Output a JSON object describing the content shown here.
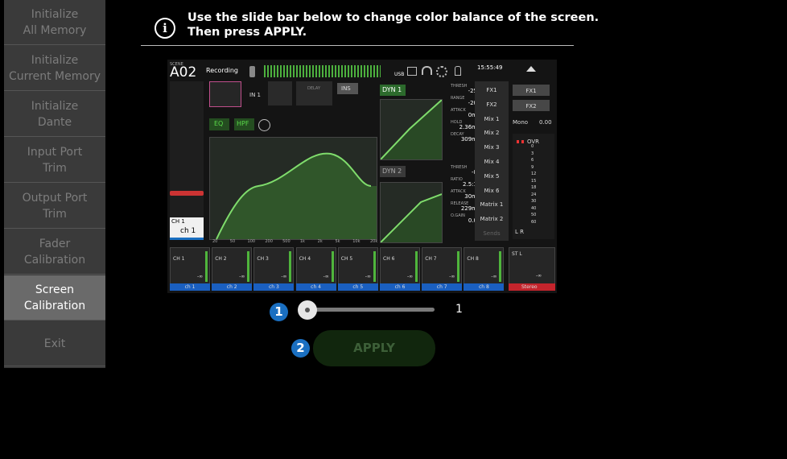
{
  "sidebar": {
    "items": [
      {
        "lines": [
          "Initialize",
          "All Memory"
        ],
        "active": false
      },
      {
        "lines": [
          "Initialize",
          "Current Memory"
        ],
        "active": false
      },
      {
        "lines": [
          "Initialize",
          "Dante"
        ],
        "active": false
      },
      {
        "lines": [
          "Input Port",
          "Trim"
        ],
        "active": false
      },
      {
        "lines": [
          "Output Port",
          "Trim"
        ],
        "active": false
      },
      {
        "lines": [
          "Fader",
          "Calibration"
        ],
        "active": false
      },
      {
        "lines": [
          "Screen",
          "Calibration"
        ],
        "active": true
      },
      {
        "lines": [
          "Exit"
        ],
        "active": false
      }
    ]
  },
  "instruction": {
    "line1": "Use the slide bar below to change color balance of the screen.",
    "line2": "Then press APPLY."
  },
  "preview": {
    "scene_label": "SCENE",
    "scene_number": "A02",
    "scene_name": "Recording",
    "usb_label": "USB",
    "time": "15:55:49",
    "eq_label": "EQ",
    "hpf_label": "HPF",
    "dyn1_label": "DYN 1",
    "dyn2_label": "DYN 2",
    "ins_label": "INS",
    "delay_label": "DELAY",
    "in1_label": "IN 1",
    "dyn1_params": [
      {
        "name": "THRESH",
        "value": "-25"
      },
      {
        "name": "RANGE",
        "value": "-20"
      },
      {
        "name": "ATTACK",
        "value": "0m"
      },
      {
        "name": "HOLD",
        "value": "2.36m"
      },
      {
        "name": "DECAY",
        "value": "309m"
      }
    ],
    "dyn2_params": [
      {
        "name": "THRESH",
        "value": "-8"
      },
      {
        "name": "RATIO",
        "value": "2.5:1"
      },
      {
        "name": "ATTACK",
        "value": "30m"
      },
      {
        "name": "RELEASE",
        "value": "229m"
      },
      {
        "name": "O.GAIN",
        "value": "0.0"
      }
    ],
    "send_buttons": [
      "FX1",
      "FX2",
      "Mix 1",
      "Mix 2",
      "Mix 3",
      "Mix 4",
      "Mix 5",
      "Mix 6",
      "Matrix 1",
      "Matrix 2",
      "Sends"
    ],
    "fx_buttons": [
      "FX1",
      "FX2"
    ],
    "mono_label": "Mono",
    "mono_value": "0.00",
    "ovr_label": "OVR",
    "meter_scale": [
      "0",
      "3",
      "6",
      "9",
      "12",
      "15",
      "18",
      "24",
      "30",
      "40",
      "50",
      "60"
    ],
    "lr_label": "L  R",
    "freq_labels": [
      "20",
      "50",
      "100",
      "200",
      "500",
      "1k",
      "2k",
      "5k",
      "10k",
      "20k"
    ],
    "channel_name": "CH 1",
    "channel_sub": "ch 1",
    "channels": [
      {
        "top": "CH 1",
        "bottom": "ch 1",
        "value": "-∞"
      },
      {
        "top": "CH 2",
        "bottom": "ch 2",
        "value": "-∞"
      },
      {
        "top": "CH 3",
        "bottom": "ch 3",
        "value": "-∞"
      },
      {
        "top": "CH 4",
        "bottom": "ch 4",
        "value": "-∞"
      },
      {
        "top": "CH 5",
        "bottom": "ch 5",
        "value": "-∞"
      },
      {
        "top": "CH 6",
        "bottom": "ch 6",
        "value": "-∞"
      },
      {
        "top": "CH 7",
        "bottom": "ch 7",
        "value": "-∞"
      },
      {
        "top": "CH 8",
        "bottom": "ch 8",
        "value": "-∞"
      }
    ],
    "stereo": {
      "top": "ST L",
      "bottom": "Stereo",
      "value": "-∞"
    }
  },
  "slider": {
    "badge": "1",
    "value": "1",
    "fraction": 0.0
  },
  "apply": {
    "badge": "2",
    "label": "APPLY"
  }
}
